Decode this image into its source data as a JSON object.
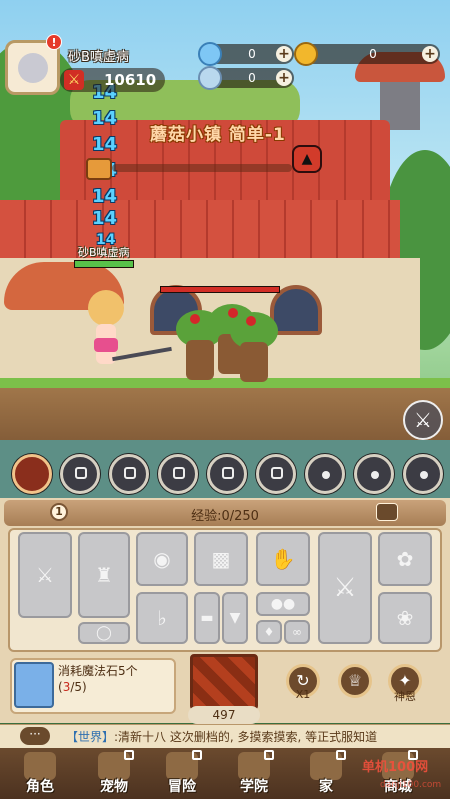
{
  "player": {
    "name": "砂B嗔虚病",
    "power": "10610",
    "alert": "!"
  },
  "resources": [
    {
      "icon": "diamond-icon",
      "value": "0"
    },
    {
      "icon": "gold-coin-icon",
      "value": "0"
    },
    {
      "icon": "crystal-icon",
      "value": "0"
    }
  ],
  "stage": {
    "title": "蘑菇小镇 简单-1",
    "damage_numbers": [
      "14",
      "14",
      "14",
      "14",
      "14",
      "14",
      "14"
    ],
    "hero_tag": "砂B嗔虚病",
    "hero_hp": 1.0,
    "enemy_hp": 1.0
  },
  "skills": {
    "locked_count": 6,
    "paw_count": 3
  },
  "panel": {
    "level": "1",
    "exp_label": "经验:0/250"
  },
  "stone": {
    "title": "消耗魔法石5个",
    "current": "3",
    "total": "/5)",
    "open": "("
  },
  "big_skill": {
    "count": "497"
  },
  "round_buttons": [
    {
      "label": "X1",
      "icon": "refresh-icon"
    },
    {
      "label": "",
      "icon": "crown-icon"
    },
    {
      "label": "神恩",
      "icon": "blessing-icon"
    }
  ],
  "chat": {
    "bubble": "···",
    "channel": "【世界】",
    "message": ":清新十八  这次删档的, 多摸索摸索, 等正式服知道"
  },
  "nav": [
    {
      "label": "角色"
    },
    {
      "label": "宠物"
    },
    {
      "label": "冒险"
    },
    {
      "label": "学院"
    },
    {
      "label": "家"
    },
    {
      "label": "商城"
    }
  ],
  "watermark": "单机100网",
  "watermark_url": "danji100.com"
}
